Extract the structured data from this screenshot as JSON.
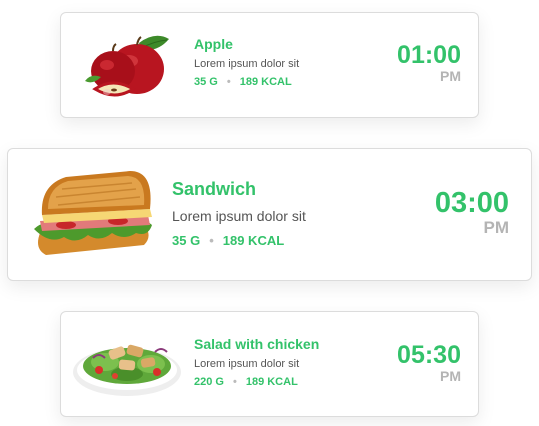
{
  "meals": [
    {
      "name": "Apple",
      "description": "Lorem ipsum dolor sit",
      "weight": "35 G",
      "calories": "189 KCAL",
      "separator": "•",
      "time": "01:00",
      "period": "PM",
      "image": "apple-image"
    },
    {
      "name": "Sandwich",
      "description": "Lorem ipsum dolor sit",
      "weight": "35 G",
      "calories": "189 KCAL",
      "separator": "•",
      "time": "03:00",
      "period": "PM",
      "image": "sandwich-image"
    },
    {
      "name": "Salad with chicken",
      "description": "Lorem ipsum dolor sit",
      "weight": "220 G",
      "calories": "189 KCAL",
      "separator": "•",
      "time": "05:30",
      "period": "PM",
      "image": "salad-image"
    }
  ],
  "colors": {
    "accent": "#33c26a",
    "muted": "#b4b4b4",
    "text": "#555555"
  }
}
